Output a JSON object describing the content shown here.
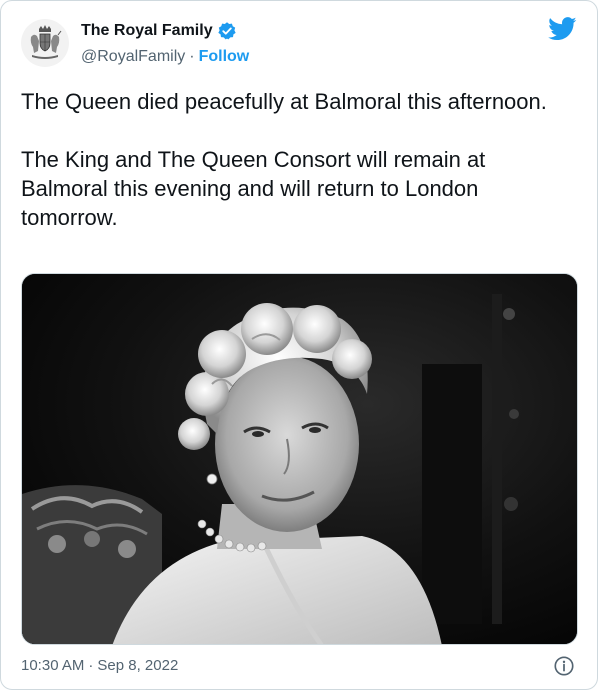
{
  "account": {
    "display_name": "The Royal Family",
    "handle": "@RoyalFamily",
    "separator": "·",
    "follow_label": "Follow",
    "verified": true
  },
  "tweet": {
    "text": "The Queen died peacefully at Balmoral this afternoon.\n\nThe King and The Queen Consort will remain at Balmoral this evening and will return to London tomorrow.",
    "time": "10:30 AM",
    "date_separator": "·",
    "date": "Sep 8, 2022"
  },
  "colors": {
    "accent": "#1d9bf0",
    "text": "#0f1419",
    "secondary": "#536471",
    "border": "#cfd9de"
  },
  "icons": {
    "brand": "twitter-bird-icon",
    "verified": "verified-badge-icon",
    "info": "info-icon",
    "avatar": "royal-coat-of-arms"
  }
}
